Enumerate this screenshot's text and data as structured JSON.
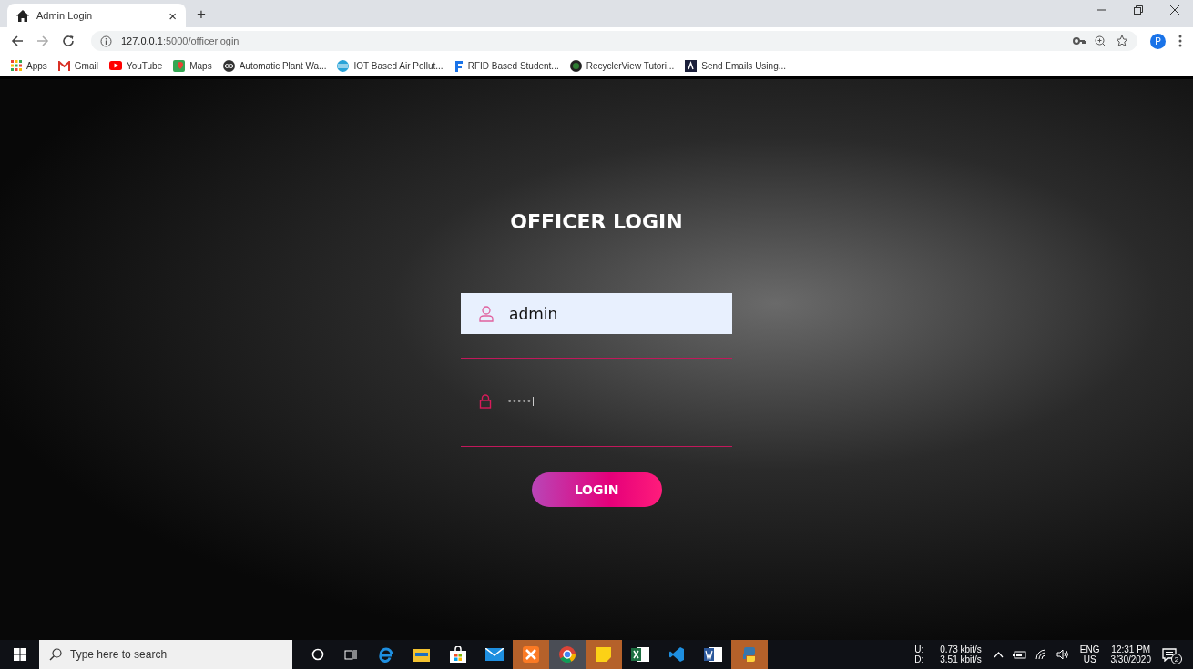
{
  "browser": {
    "tab": {
      "title": "Admin Login",
      "close": "×",
      "new_tab": "+"
    },
    "url": {
      "host": "127.0.0.1",
      "path": ":5000/officerlogin"
    },
    "profile": "P",
    "bookmarks": [
      {
        "label": "Apps",
        "kind": "apps"
      },
      {
        "label": "Gmail",
        "kind": "gmail"
      },
      {
        "label": "YouTube",
        "kind": "youtube"
      },
      {
        "label": "Maps",
        "kind": "maps"
      },
      {
        "label": "Automatic Plant Wa...",
        "kind": "owl"
      },
      {
        "label": "IOT Based Air Pollut...",
        "kind": "globe"
      },
      {
        "label": "RFID Based Student...",
        "kind": "letter"
      },
      {
        "label": "RecyclerView Tutori...",
        "kind": "bug"
      },
      {
        "label": "Send Emails Using...",
        "kind": "square"
      }
    ]
  },
  "page": {
    "title": "OFFICER LOGIN",
    "fields": [
      {
        "kind": "user",
        "value": "admin",
        "autofilled": true
      },
      {
        "kind": "lock",
        "value": "•••••",
        "autofilled": false
      }
    ],
    "button": "LOGIN"
  },
  "taskbar": {
    "search": {
      "placeholder": "Type here to search"
    },
    "network": {
      "up_label": "U:",
      "down_label": "D:",
      "up": "0.73 kbit/s",
      "down": "3.51 kbit/s"
    },
    "language": {
      "lang": "ENG",
      "region": "US"
    },
    "clock": {
      "time": "12:31 PM",
      "date": "3/30/2020"
    },
    "notifications": "2"
  }
}
